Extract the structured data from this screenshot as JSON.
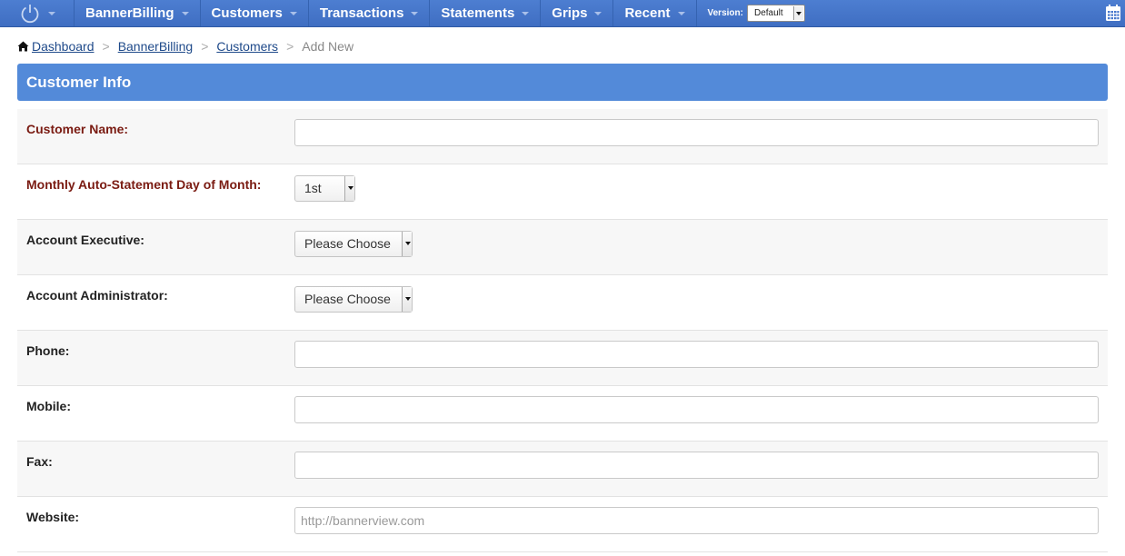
{
  "nav": {
    "items": [
      {
        "label": "BannerBilling"
      },
      {
        "label": "Customers"
      },
      {
        "label": "Transactions"
      },
      {
        "label": "Statements"
      },
      {
        "label": "Grips"
      },
      {
        "label": "Recent"
      }
    ],
    "version_label": "Version:",
    "version_value": "Default"
  },
  "breadcrumb": {
    "items": [
      "Dashboard",
      "BannerBilling",
      "Customers"
    ],
    "separator": ">",
    "current": "Add New"
  },
  "panel": {
    "title": "Customer Info"
  },
  "form": {
    "customer_name": {
      "label": "Customer Name:",
      "value": ""
    },
    "statement_day": {
      "label": "Monthly Auto-Statement Day of Month:",
      "value": "1st"
    },
    "account_executive": {
      "label": "Account Executive:",
      "value": "Please Choose"
    },
    "account_administrator": {
      "label": "Account Administrator:",
      "value": "Please Choose"
    },
    "phone": {
      "label": "Phone:",
      "value": ""
    },
    "mobile": {
      "label": "Mobile:",
      "value": ""
    },
    "fax": {
      "label": "Fax:",
      "value": ""
    },
    "website": {
      "label": "Website:",
      "value": "",
      "placeholder": "http://bannerview.com"
    }
  },
  "colors": {
    "nav_bg": "#4677cc",
    "panel_header_bg": "#538ad9",
    "required_label": "#7a1b12"
  }
}
